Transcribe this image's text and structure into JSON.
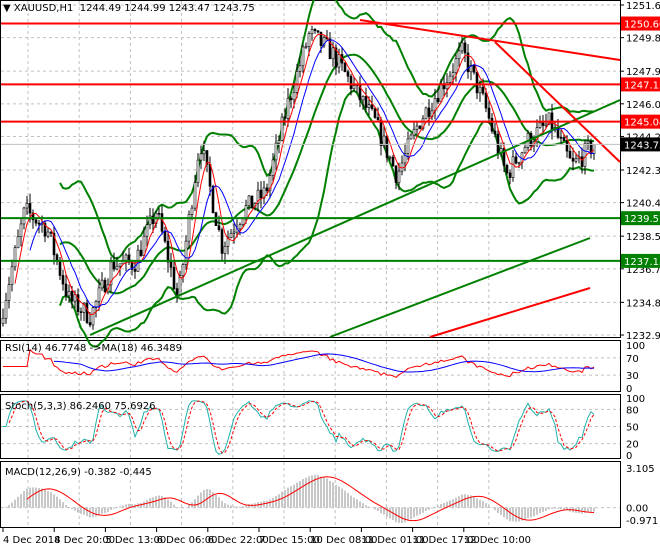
{
  "header": {
    "symbol": "XAUUSD,H1",
    "open": "1244.49",
    "high": "1244.99",
    "low": "1243.47",
    "close": "1243.75"
  },
  "chart_data": {
    "type": "candlestick",
    "price_axis": {
      "min": 1232.95,
      "max": 1251.65,
      "ticks": [
        "1251.65",
        "1249.80",
        "1247.90",
        "1246.05",
        "1244.20",
        "1242.30",
        "1240.45",
        "1238.55",
        "1236.70",
        "1234.80",
        "1232.95"
      ]
    },
    "time_axis": [
      "4 Dec 2018",
      "4 Dec 20:00",
      "5 Dec 13:00",
      "6 Dec 06:00",
      "6 Dec 22:00",
      "7 Dec 15:00",
      "10 Dec 08:00",
      "11 Dec 01:00",
      "11 Dec 17:00",
      "12 Dec 10:00"
    ],
    "approx_close_path": [
      1234.5,
      1240,
      1239,
      1235,
      1234,
      1237,
      1237,
      1240,
      1235,
      1244,
      1238,
      1240,
      1241,
      1246,
      1250,
      1249,
      1247,
      1245,
      1242,
      1245,
      1247,
      1249,
      1246,
      1242,
      1244,
      1245,
      1242.5,
      1243.75
    ],
    "levels": [
      {
        "price": "1250.60",
        "color": "#ff0000"
      },
      {
        "price": "1247.15",
        "color": "#ff0000"
      },
      {
        "price": "1245.04",
        "color": "#ff0000"
      },
      {
        "price": "1239.57",
        "color": "#008000"
      },
      {
        "price": "1237.15",
        "color": "#008000"
      }
    ],
    "current_price": "1243.75",
    "rsi": {
      "label": "RSI(14) 46.7748  ->MA(18) 46.3489",
      "ticks": [
        "100",
        "70",
        "30",
        "0"
      ]
    },
    "stoch": {
      "label": "Stoch(5,3,3) 86.2460 75.6926",
      "ticks": [
        "100",
        "80",
        "50",
        "20",
        "0"
      ]
    },
    "macd": {
      "label": "MACD(12,26,9) -0.382 -0.445",
      "ticks": [
        "3.105",
        "0.00",
        "-0.971"
      ]
    },
    "colors": {
      "up": "#ffffff",
      "down": "#000000",
      "bands": "#008000",
      "ma_fast": "#ff0000",
      "ma_slow": "#0000ff",
      "stoch_main": "#20b2aa",
      "signal": "#ff0000"
    }
  }
}
